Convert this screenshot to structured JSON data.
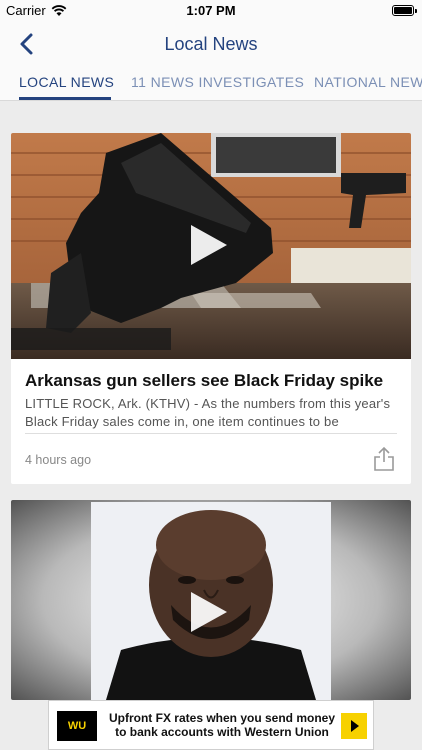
{
  "status_bar": {
    "carrier": "Carrier",
    "time": "1:07 PM"
  },
  "nav": {
    "title": "Local News",
    "back_icon": "chevron-left-icon"
  },
  "tabs": [
    {
      "label": "LOCAL NEWS",
      "active": true
    },
    {
      "label": "11 NEWS INVESTIGATES",
      "active": false
    },
    {
      "label": "NATIONAL NEWS",
      "active": false
    }
  ],
  "stories": [
    {
      "headline": "Arkansas gun sellers see Black Friday spike",
      "summary": "LITTLE ROCK, Ark. (KTHV) - As the numbers from this year's Black Friday sales come in, one item continues to be",
      "time_ago": "4 hours ago",
      "has_video": true
    },
    {
      "has_video": true
    }
  ],
  "ad": {
    "logo": "WU",
    "text": "Upfront FX rates when you send money to bank accounts with Western Union"
  },
  "colors": {
    "accent": "#24437f",
    "tab_inactive": "#7b8fb5",
    "ad_yellow": "#f7d100"
  }
}
